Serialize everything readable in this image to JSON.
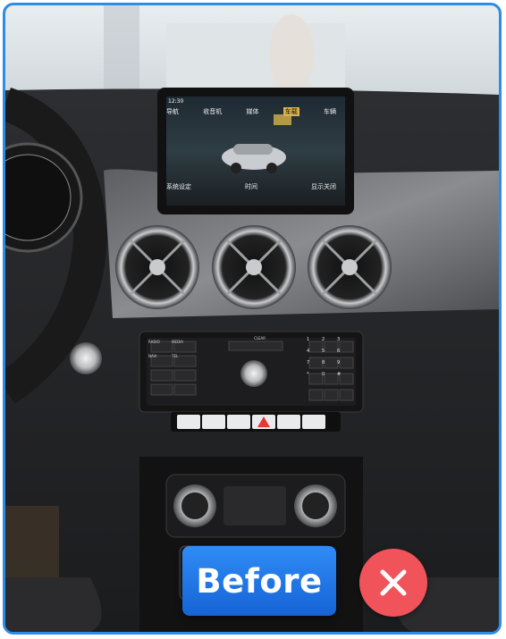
{
  "photo": {
    "subject": "car-dashboard-photo",
    "screen": {
      "clock": "12:30",
      "menu_top": [
        "导航",
        "收音机",
        "媒体",
        "车载",
        "车辆"
      ],
      "menu_bottom": [
        "系统设定",
        "时间",
        "显示关闭"
      ]
    },
    "radio_panel": {
      "left_buttons": [
        "RADIO",
        "MEDIA",
        "NAVI",
        "TEL"
      ],
      "top_buttons": [
        "CLEAR"
      ],
      "hazard_label": "",
      "numpad": [
        "1",
        "2",
        "3",
        "4",
        "5",
        "6",
        "7",
        "8",
        "9",
        "*",
        "0",
        "#"
      ]
    }
  },
  "badge": {
    "label": "Before"
  },
  "icons": {
    "close": "close-icon"
  },
  "colors": {
    "frame": "#2c8de8",
    "badge": "#1f74e6",
    "close": "#f1535a"
  }
}
